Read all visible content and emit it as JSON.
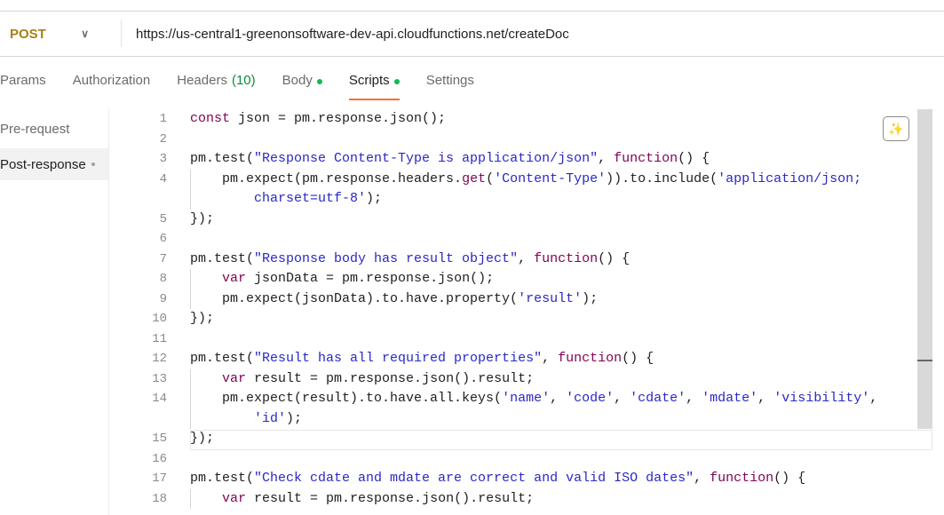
{
  "request": {
    "method": "POST",
    "url": "https://us-central1-greenonsoftware-dev-api.cloudfunctions.net/createDoc"
  },
  "tabs": [
    {
      "label": "Params"
    },
    {
      "label": "Authorization"
    },
    {
      "label": "Headers",
      "count": "(10)"
    },
    {
      "label": "Body",
      "dot": true
    },
    {
      "label": "Scripts",
      "dot": true,
      "active": true
    },
    {
      "label": "Settings"
    }
  ],
  "script_tabs": [
    {
      "label": "Pre-request"
    },
    {
      "label": "Post-response",
      "active": true,
      "dot": true
    }
  ],
  "colors": {
    "accent": "#ff6c37",
    "method": "#a6801a",
    "dot": "#0cbb52",
    "keyword": "#800555",
    "string": "#2a28c6"
  },
  "icons": {
    "beautify": "magic-wand-icon",
    "method_dropdown": "chevron-down-icon"
  },
  "code_rows": [
    {
      "n": "1",
      "t": [
        [
          "k",
          "const"
        ],
        [
          "p",
          " json = pm.response.json();"
        ]
      ]
    },
    {
      "n": "2",
      "t": []
    },
    {
      "n": "3",
      "t": [
        [
          "p",
          "pm.test("
        ],
        [
          "s",
          "\"Response Content-Type is application/json\""
        ],
        [
          "p",
          ", "
        ],
        [
          "k",
          "function"
        ],
        [
          "p",
          "() {"
        ]
      ]
    },
    {
      "n": "4",
      "i": 1,
      "t": [
        [
          "p",
          "    pm.expect(pm.response.headers."
        ],
        [
          "k",
          "get"
        ],
        [
          "p",
          "("
        ],
        [
          "s",
          "'Content-Type'"
        ],
        [
          "p",
          ")).to.include("
        ],
        [
          "s",
          "'application/json;"
        ]
      ]
    },
    {
      "n": "",
      "i": 1,
      "t": [
        [
          "s",
          "        charset=utf-8'"
        ],
        [
          "p",
          ");"
        ]
      ]
    },
    {
      "n": "5",
      "t": [
        [
          "p",
          "});"
        ]
      ]
    },
    {
      "n": "6",
      "t": []
    },
    {
      "n": "7",
      "t": [
        [
          "p",
          "pm.test("
        ],
        [
          "s",
          "\"Response body has result object\""
        ],
        [
          "p",
          ", "
        ],
        [
          "k",
          "function"
        ],
        [
          "p",
          "() {"
        ]
      ]
    },
    {
      "n": "8",
      "i": 1,
      "t": [
        [
          "p",
          "    "
        ],
        [
          "k",
          "var"
        ],
        [
          "p",
          " jsonData = pm.response.json();"
        ]
      ]
    },
    {
      "n": "9",
      "i": 1,
      "t": [
        [
          "p",
          "    pm.expect(jsonData).to.have.property("
        ],
        [
          "s",
          "'result'"
        ],
        [
          "p",
          ");"
        ]
      ]
    },
    {
      "n": "10",
      "t": [
        [
          "p",
          "});"
        ]
      ]
    },
    {
      "n": "11",
      "t": []
    },
    {
      "n": "12",
      "t": [
        [
          "p",
          "pm.test("
        ],
        [
          "s",
          "\"Result has all required properties\""
        ],
        [
          "p",
          ", "
        ],
        [
          "k",
          "function"
        ],
        [
          "p",
          "() {"
        ]
      ]
    },
    {
      "n": "13",
      "i": 1,
      "t": [
        [
          "p",
          "    "
        ],
        [
          "k",
          "var"
        ],
        [
          "p",
          " result = pm.response.json().result;"
        ]
      ]
    },
    {
      "n": "14",
      "i": 1,
      "t": [
        [
          "p",
          "    pm.expect(result).to.have.all.keys("
        ],
        [
          "s",
          "'name'"
        ],
        [
          "p",
          ", "
        ],
        [
          "s",
          "'code'"
        ],
        [
          "p",
          ", "
        ],
        [
          "s",
          "'cdate'"
        ],
        [
          "p",
          ", "
        ],
        [
          "s",
          "'mdate'"
        ],
        [
          "p",
          ", "
        ],
        [
          "s",
          "'visibility'"
        ],
        [
          "p",
          ","
        ]
      ]
    },
    {
      "n": "",
      "i": 1,
      "t": [
        [
          "s",
          "        'id'"
        ],
        [
          "p",
          ");"
        ]
      ]
    },
    {
      "n": "15",
      "t": [
        [
          "p",
          "});"
        ]
      ]
    },
    {
      "n": "16",
      "t": []
    },
    {
      "n": "17",
      "t": [
        [
          "p",
          "pm.test("
        ],
        [
          "s",
          "\"Check cdate and mdate are correct and valid ISO dates\""
        ],
        [
          "p",
          ", "
        ],
        [
          "k",
          "function"
        ],
        [
          "p",
          "() {"
        ]
      ]
    },
    {
      "n": "18",
      "i": 1,
      "t": [
        [
          "p",
          "    "
        ],
        [
          "k",
          "var"
        ],
        [
          "p",
          " result = pm.response.json().result;"
        ]
      ]
    }
  ]
}
